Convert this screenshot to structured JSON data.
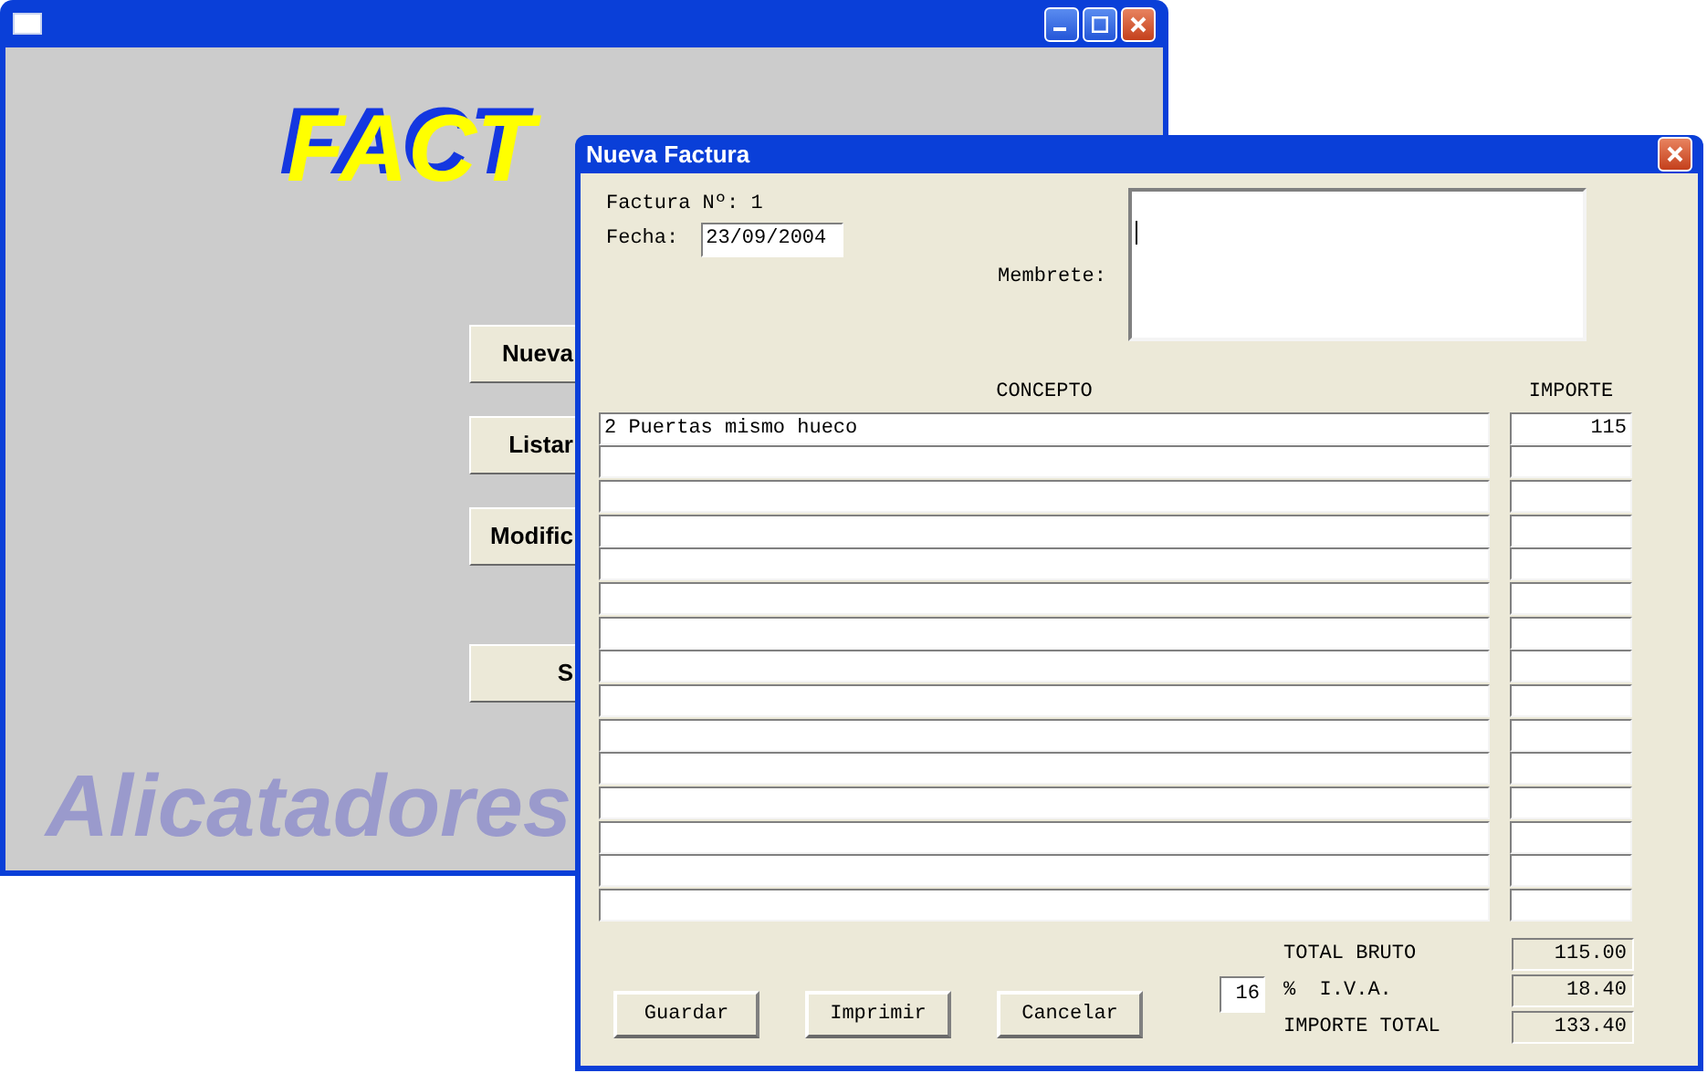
{
  "main_window": {
    "logo": "FACT",
    "buttons": [
      "Nueva",
      "Listar",
      "Modific",
      "S"
    ],
    "footer": "Alicatadores"
  },
  "dialog": {
    "title": "Nueva Factura",
    "invoice_number_label": "Factura Nº: 1",
    "date_label": "Fecha:",
    "date_value": "23/09/2004",
    "letterhead_label": "Membrete:",
    "columns": [
      "CONCEPTO",
      "IMPORTE"
    ],
    "rows": [
      {
        "concepto": "2 Puertas mismo hueco",
        "importe": "115"
      },
      {},
      {},
      {},
      {},
      {},
      {},
      {},
      {},
      {},
      {},
      {},
      {},
      {},
      {}
    ],
    "totals": [
      {
        "label": "TOTAL BRUTO",
        "value": "115.00"
      },
      {
        "label": "%  I.V.A.",
        "value": "18.40"
      },
      {
        "label": "IMPORTE TOTAL",
        "value": "133.40"
      }
    ],
    "vat_rate": "16",
    "buttons": [
      "Guardar",
      "Imprimir",
      "Cancelar"
    ]
  }
}
